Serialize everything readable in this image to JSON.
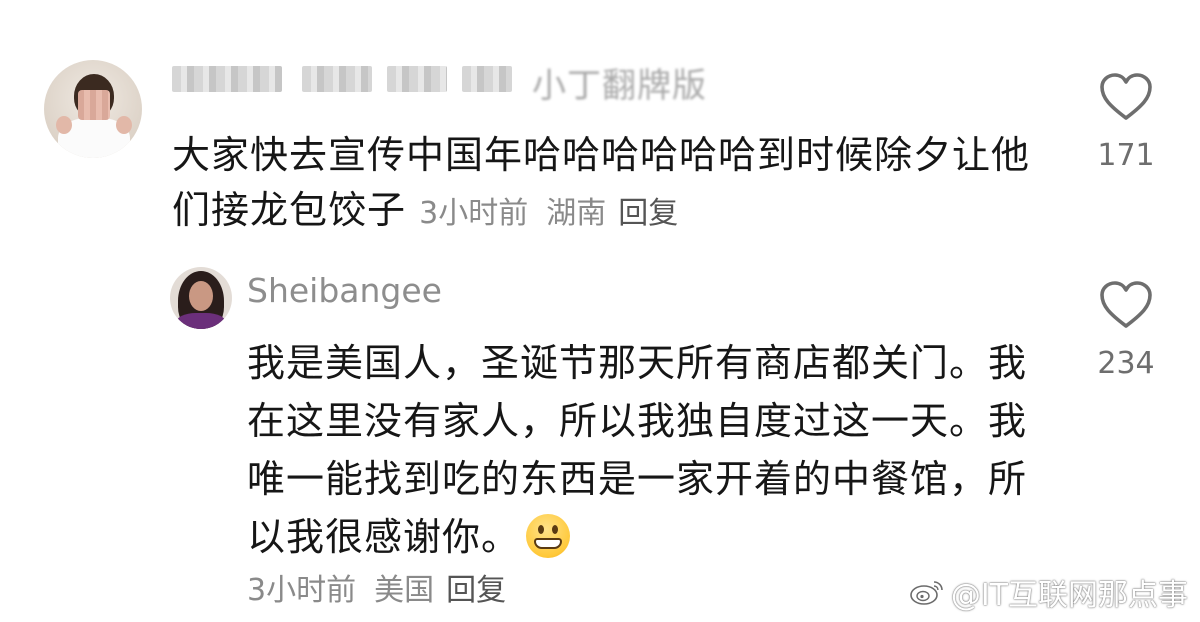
{
  "comments": [
    {
      "username_visible_fragment": "小丁翻牌版",
      "body": "大家快去宣传中国年哈哈哈哈哈哈到时候除夕让他们接龙包饺子",
      "meta": {
        "time": "3小时前",
        "location": "湖南",
        "reply_label": "回复"
      },
      "likes": "171"
    },
    {
      "username": "Sheibangee",
      "body": "我是美国人，圣诞节那天所有商店都关门。我在这里没有家人，所以我独自度过这一天。我唯一能找到吃的东西是一家开着的中餐馆，所以我很感谢你。",
      "meta": {
        "time": "3小时前",
        "location": "美国",
        "reply_label": "回复"
      },
      "likes": "234"
    }
  ],
  "icons": {
    "like": "heart-outline-icon",
    "emoji": "grinning-face-emoji",
    "watermark": "weibo-logo-icon"
  },
  "watermark": {
    "text": "@IT互联网那点事"
  },
  "colors": {
    "text": "#161616",
    "meta": "#8a8a8a",
    "username": "#8d8d8d",
    "like_icon": "#6e6e6e"
  }
}
